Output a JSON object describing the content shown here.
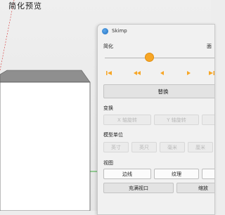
{
  "viewport": {
    "label": "简化预览"
  },
  "window": {
    "title": "Skimp"
  },
  "simplify": {
    "label": "简化",
    "label_right": "面",
    "slider_value_fraction": 0.38
  },
  "playback": {
    "icons": [
      "skip-to-start-icon",
      "rewind-icon",
      "step-back-icon",
      "step-forward-icon",
      "skip-to-end-icon"
    ],
    "color": "#f7a626"
  },
  "replace_button": "替换",
  "transform": {
    "label": "变换",
    "buttons": [
      "X 轴旋转",
      "Y 轴旋转"
    ]
  },
  "model_units": {
    "label": "模型单位",
    "buttons": [
      "英寸",
      "英尺",
      "毫米",
      "厘米"
    ]
  },
  "view": {
    "label": "视图",
    "buttons_row1": [
      "边线",
      "纹理"
    ],
    "buttons_row2": [
      "充满视口",
      "缩放"
    ]
  },
  "colors": {
    "accent": "#f7a626",
    "axis_green": "#3fae3f",
    "axis_red": "#d94a4a"
  }
}
